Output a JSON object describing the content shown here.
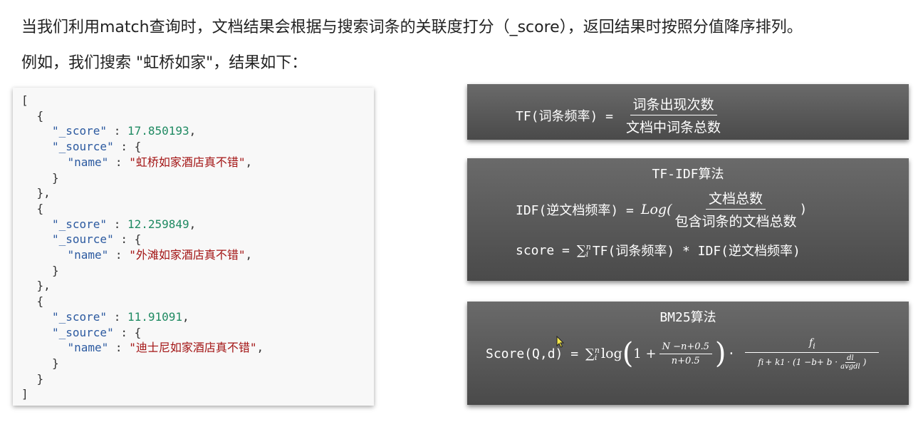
{
  "intro": {
    "line1": "当我们利用match查询时，文档结果会根据与搜索词条的关联度打分（_score），返回结果时按照分值降序排列。",
    "line2": "例如，我们搜索 \"虹桥如家\"，结果如下："
  },
  "code": {
    "lines": [
      {
        "t": "[",
        "indent": 0
      },
      {
        "t": "{",
        "indent": 1
      },
      {
        "key": "\"_score\"",
        "num": "17.850193",
        "indent": 2
      },
      {
        "key": "\"_source\"",
        "open": "{",
        "indent": 2
      },
      {
        "key": "\"name\"",
        "str": "\"虹桥如家酒店真不错\"",
        "indent": 3
      },
      {
        "t": "}",
        "indent": 2
      },
      {
        "t": "},",
        "indent": 1
      },
      {
        "t": "{",
        "indent": 1
      },
      {
        "key": "\"_score\"",
        "num": "12.259849",
        "indent": 2
      },
      {
        "key": "\"_source\"",
        "open": "{",
        "indent": 2
      },
      {
        "key": "\"name\"",
        "str": "\"外滩如家酒店真不错\"",
        "indent": 3
      },
      {
        "t": "}",
        "indent": 2
      },
      {
        "t": "},",
        "indent": 1
      },
      {
        "t": "{",
        "indent": 1
      },
      {
        "key": "\"_score\"",
        "num": "11.91091",
        "indent": 2
      },
      {
        "key": "\"_source\"",
        "open": "{",
        "indent": 2
      },
      {
        "key": "\"name\"",
        "str": "\"迪士尼如家酒店真不错\"",
        "indent": 3
      },
      {
        "t": "}",
        "indent": 2
      },
      {
        "t": "}",
        "indent": 1
      },
      {
        "t": "]",
        "indent": 0
      }
    ]
  },
  "tf": {
    "lhs": "TF(词条频率) =",
    "num": "词条出现次数",
    "den": "文档中词条总数"
  },
  "tfidf": {
    "title": "TF-IDF算法",
    "idf_lhs": "IDF(逆文档频率) =",
    "log": "Log(",
    "num": "文档总数",
    "den": "包含词条的文档总数",
    "close": ")",
    "score_lhs": "score =",
    "sigma": "∑",
    "sup": "n",
    "sub": "i",
    "score_rhs": "TF(词条频率) * IDF(逆文档频率)"
  },
  "bm25": {
    "title": "BM25算法",
    "lhs": "Score(Q,d) =",
    "sigma": "∑",
    "sup": "n",
    "sub": "i",
    "log": "log",
    "one_plus": "1 +",
    "frac1_num": "N −n+0.5",
    "frac1_den": "n+0.5",
    "dot": "·",
    "frac2_num": "f",
    "frac2_num_sub": "i",
    "frac2_den_a": "f",
    "frac2_den_a_sub": "i",
    "frac2_den_b": "+ k",
    "frac2_den_b_sub": "1",
    "frac2_den_c": "· (1 −b+ b ·",
    "dl": "dl",
    "avgdl": "avgdl",
    "frac2_den_close": ")"
  }
}
